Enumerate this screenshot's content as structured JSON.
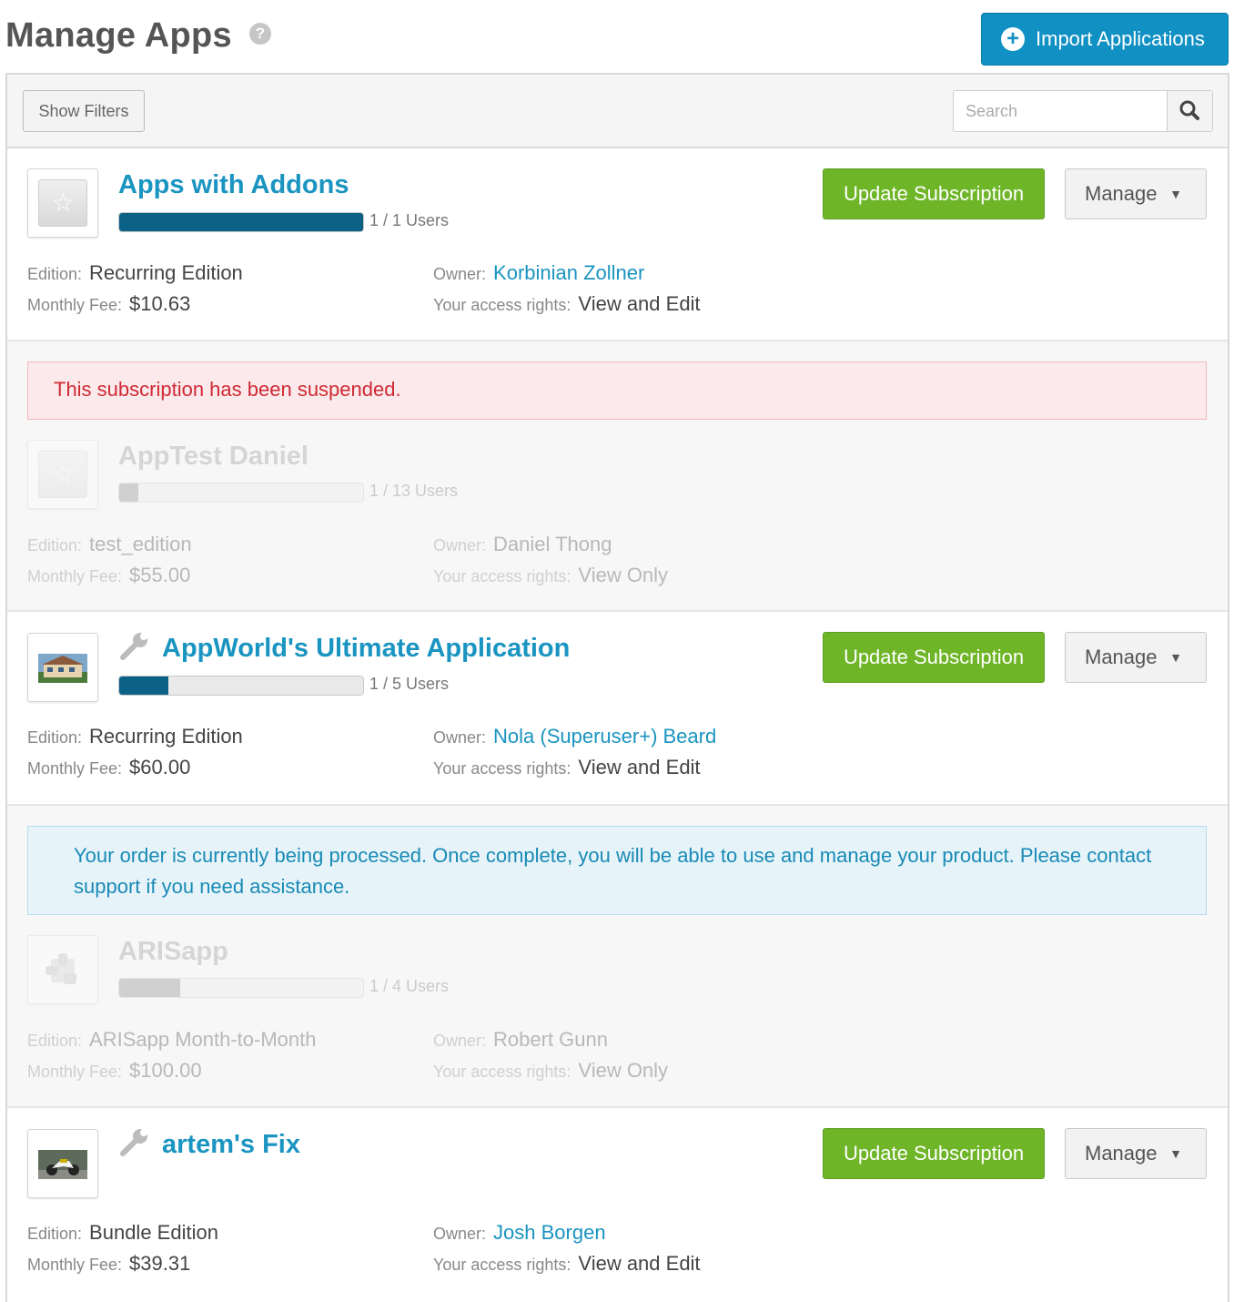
{
  "header": {
    "title": "Manage Apps",
    "help_glyph": "?",
    "import_label": "Import Applications",
    "import_icon": "plus-circle-icon",
    "accent_color": "#1191c3"
  },
  "toolbar": {
    "show_filters_label": "Show Filters",
    "search_placeholder": "Search",
    "search_icon": "magnifier-icon"
  },
  "labels": {
    "edition": "Edition:",
    "monthly_fee": "Monthly Fee:",
    "owner": "Owner:",
    "access_rights": "Your access rights:",
    "update_subscription": "Update Subscription",
    "manage": "Manage",
    "caret": "▼"
  },
  "apps": [
    {
      "name": "Apps with Addons",
      "users": "1 / 1 Users",
      "usage_fraction": 1.0,
      "edition": "Recurring Edition",
      "monthly_fee": "$10.63",
      "owner": "Korbinian Zollner",
      "access": "View and Edit",
      "status": "active"
    },
    {
      "alert": "This subscription has been suspended.",
      "name": "AppTest Daniel",
      "users": "1 / 13 Users",
      "usage_fraction": 0.077,
      "edition": "test_edition",
      "monthly_fee": "$55.00",
      "owner": "Daniel Thong",
      "access": "View Only",
      "status": "suspended"
    },
    {
      "name": "AppWorld's Ultimate Application",
      "users": "1 / 5 Users",
      "usage_fraction": 0.2,
      "edition": "Recurring Edition",
      "monthly_fee": "$60.00",
      "owner": "Nola (Superuser+) Beard",
      "access": "View and Edit",
      "status": "active"
    },
    {
      "alert": "Your order is currently being processed. Once complete, you will be able to use and manage your product. Please contact support if you need assistance.",
      "name": "ARISapp",
      "users": "1 / 4 Users",
      "usage_fraction": 0.25,
      "edition": "ARISapp Month-to-Month",
      "monthly_fee": "$100.00",
      "owner": "Robert Gunn",
      "access": "View Only",
      "status": "processing"
    },
    {
      "name": "artem's Fix",
      "edition": "Bundle Edition",
      "monthly_fee": "$39.31",
      "owner": "Josh Borgen",
      "access": "View and Edit",
      "status": "active"
    }
  ],
  "colors": {
    "link": "#1a94c0",
    "update_button": "#6fb528",
    "usage_bar": "#0c6187",
    "danger_text": "#cf2a34",
    "info_text": "#1a8ab5"
  }
}
